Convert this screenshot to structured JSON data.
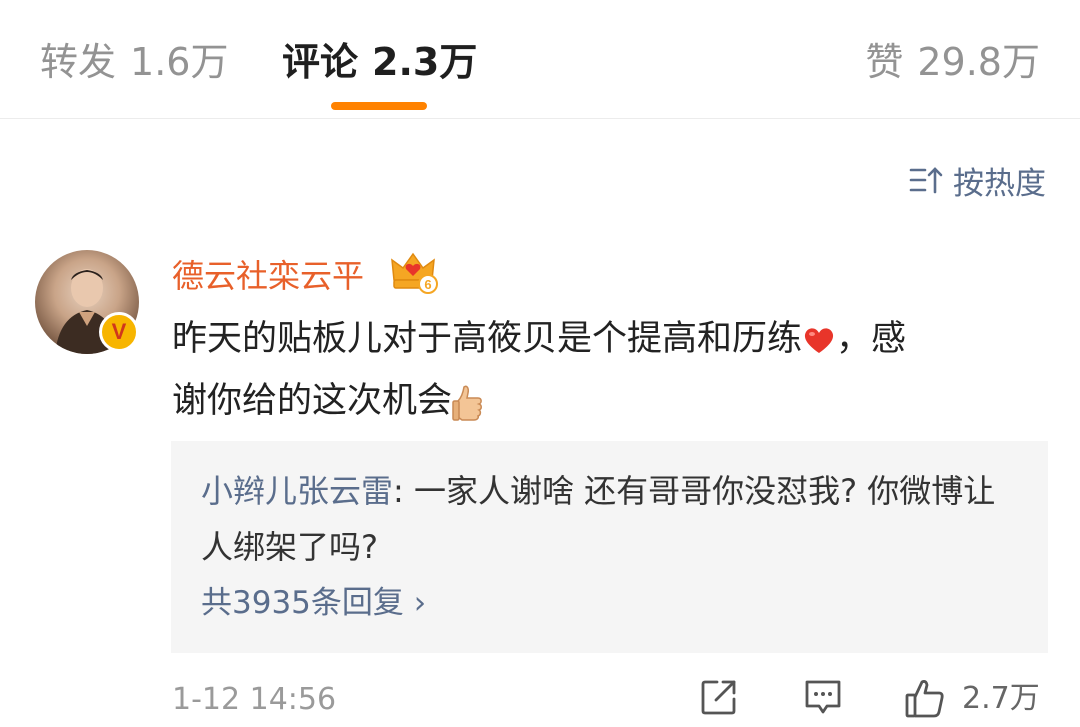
{
  "tabs": {
    "reposts": {
      "label": "转发",
      "count": "1.6万"
    },
    "comments": {
      "label": "评论",
      "count": "2.3万",
      "active": true
    },
    "likes": {
      "label": "赞",
      "count": "29.8万"
    }
  },
  "sort": {
    "label": "按热度"
  },
  "comment": {
    "username": "德云社栾云平",
    "verified_badge": "V",
    "member_level": "6",
    "text_line1": "昨天的贴板儿对于高筱贝是个提高和历练",
    "text_line1_after": "，感",
    "text_line2": "谢你给的这次机会",
    "emoji_1": "heart",
    "emoji_2": "thumbs-up",
    "timestamp": "1-12 14:56",
    "like_count": "2.7万"
  },
  "reply": {
    "username": "小辫儿张云雷",
    "text": ": 一家人谢啥 还有哥哥你没怼我? 你微博让人绑架了吗?",
    "more_label": "共3935条回复 ›"
  },
  "colors": {
    "accent": "#ff8200",
    "username": "#e8602a",
    "link": "#5a6d8c",
    "reply_bg": "#f5f5f5"
  }
}
